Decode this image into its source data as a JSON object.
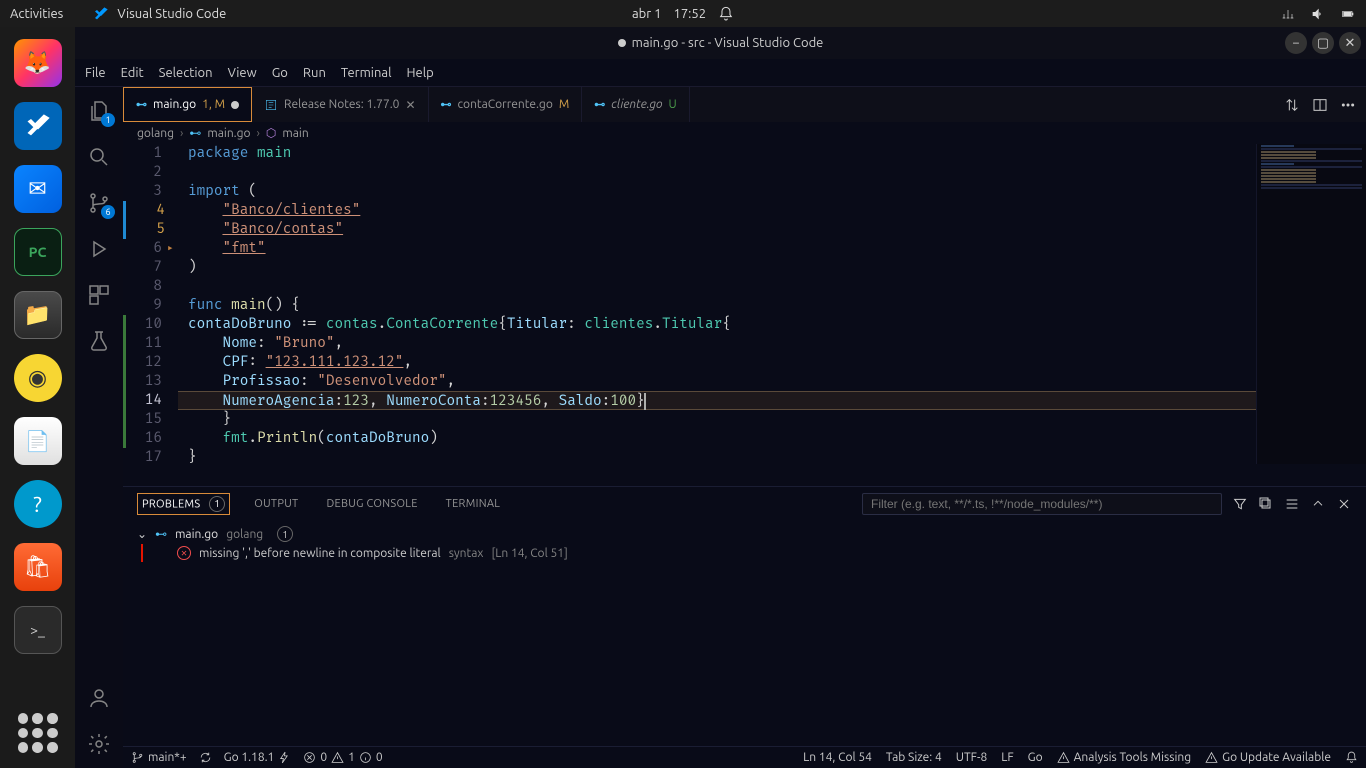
{
  "os": {
    "activities": "Activities",
    "app_label": "Visual Studio Code",
    "date": "abr 1",
    "time": "17:52"
  },
  "titlebar": {
    "title": "main.go - src - Visual Studio Code"
  },
  "menubar": [
    "File",
    "Edit",
    "Selection",
    "View",
    "Go",
    "Run",
    "Terminal",
    "Help"
  ],
  "tabs": [
    {
      "icon": "go",
      "label": "main.go",
      "suffix": "1, M",
      "active": true,
      "dirty": true
    },
    {
      "icon": "release",
      "label": "Release Notes: 1.77.0",
      "close": true
    },
    {
      "icon": "go",
      "label": "contaCorrente.go",
      "status": "M"
    },
    {
      "icon": "go",
      "label": "cliente.go",
      "status": "U",
      "italic": true
    }
  ],
  "breadcrumb": {
    "seg1": "golang",
    "seg2": "main.go",
    "seg3": "main"
  },
  "activitybar": {
    "explorer_badge": "1",
    "scm_badge": "6"
  },
  "code": {
    "lines": [
      {
        "n": 1,
        "html": "<span class='kw'>package</span> <span class='pkg'>main</span>"
      },
      {
        "n": 2,
        "html": ""
      },
      {
        "n": 3,
        "html": "<span class='kw'>import</span> <span class='op'>(</span>"
      },
      {
        "n": 4,
        "html": "    <span class='str u'>\"Banco/clientes\"</span>",
        "mod": true
      },
      {
        "n": 5,
        "html": "    <span class='str u'>\"Banco/contas\"</span>",
        "mod": true
      },
      {
        "n": 6,
        "html": "    <span class='str u'>\"fmt\"</span>",
        "marker": true
      },
      {
        "n": 7,
        "html": "<span class='op'>)</span>"
      },
      {
        "n": 8,
        "html": ""
      },
      {
        "n": 9,
        "html": "<span class='kw'>func</span> <span class='fn'>main</span><span class='op'>() {</span>"
      },
      {
        "n": 10,
        "html": "<span class='ident'>contaDoBruno</span> <span class='op'>:=</span> <span class='pkg'>contas</span><span class='op'>.</span><span class='typ'>ContaCorrente</span><span class='op'>{</span><span class='field'>Titular</span><span class='op'>:</span> <span class='pkg'>clientes</span><span class='op'>.</span><span class='typ'>Titular</span><span class='op'>{</span>",
        "add": true
      },
      {
        "n": 11,
        "html": "    <span class='field'>Nome</span><span class='op'>:</span> <span class='str'>\"Bruno\"</span><span class='op'>,</span>",
        "add": true
      },
      {
        "n": 12,
        "html": "    <span class='field'>CPF</span><span class='op'>:</span> <span class='str u'>\"123.111.123.12\"</span><span class='op'>,</span>",
        "add": true
      },
      {
        "n": 13,
        "html": "    <span class='field'>Profissao</span><span class='op'>:</span> <span class='str'>\"Desenvolvedor\"</span><span class='op'>,</span>",
        "add": true
      },
      {
        "n": 14,
        "html": "    <span class='field'>NumeroAgencia</span><span class='op'>:</span><span class='num'>123</span><span class='op'>,</span> <span class='field'>NumeroConta</span><span class='op'>:</span><span class='num'>123456</span><span class='op'>,</span> <span class='field'>Saldo</span><span class='op'>:</span><span class='num'>100</span><span class='op'>}</span><span class='cursor'></span>",
        "add": true,
        "cur": true,
        "hl": true
      },
      {
        "n": 15,
        "html": "    <span class='op'>}</span>",
        "add": true
      },
      {
        "n": 16,
        "html": "    <span class='pkg'>fmt</span><span class='op'>.</span><span class='fn'>Println</span><span class='op'>(</span><span class='ident'>contaDoBruno</span><span class='op'>)</span>",
        "add": true
      },
      {
        "n": 17,
        "html": "<span class='op'>}</span>"
      }
    ]
  },
  "panel": {
    "tabs": {
      "problems": "PROBLEMS",
      "problems_count": "1",
      "output": "OUTPUT",
      "debug": "DEBUG CONSOLE",
      "terminal": "TERMINAL"
    },
    "filter_placeholder": "Filter (e.g. text, **/*.ts, !**/node_modules/**)",
    "file": {
      "name": "main.go",
      "path": "golang",
      "count": "1"
    },
    "error": {
      "msg": "missing ',' before newline in composite literal",
      "src": "syntax",
      "loc": "[Ln 14, Col 51]"
    }
  },
  "statusbar": {
    "branch": "main*+",
    "go_version": "Go 1.18.1",
    "errors": "0",
    "warnings": "1",
    "infos": "0",
    "cursor": "Ln 14, Col 54",
    "tabsize": "Tab Size: 4",
    "encoding": "UTF-8",
    "eol": "LF",
    "lang": "Go",
    "tools": "Analysis Tools Missing",
    "update": "Go Update Available"
  }
}
